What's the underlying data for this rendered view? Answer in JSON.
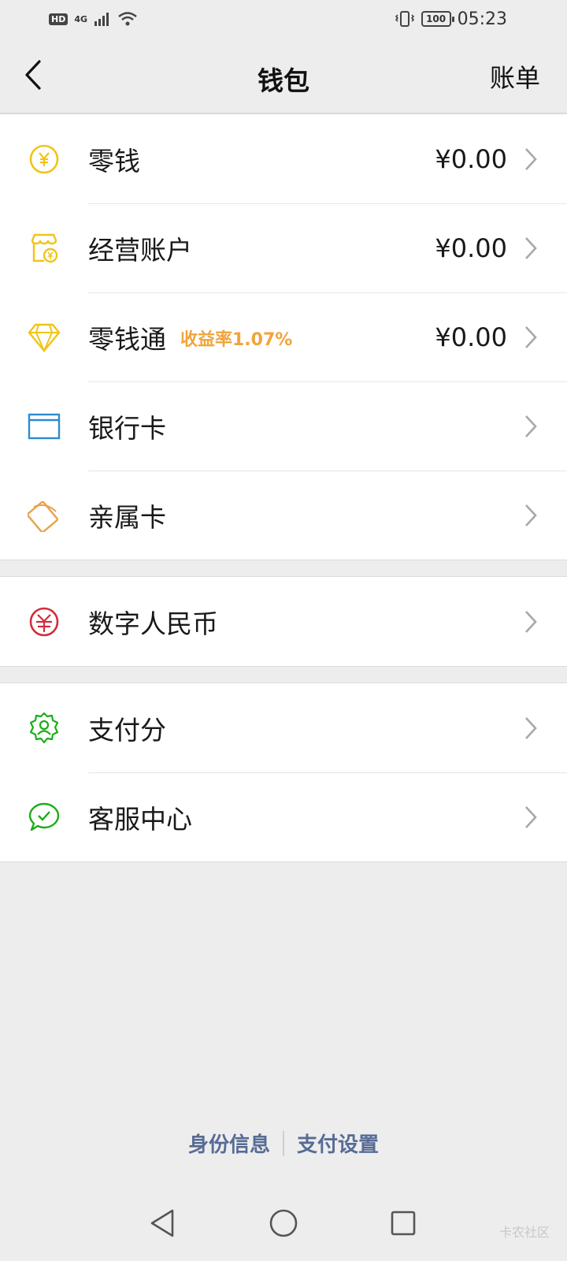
{
  "status_bar": {
    "hd": "HD",
    "network": "4G",
    "battery": "100",
    "time": "05:23"
  },
  "navbar": {
    "title": "钱包",
    "right_action": "账单"
  },
  "groups": [
    {
      "items": [
        {
          "label": "零钱",
          "value": "¥0.00",
          "icon": "yuan-coin-icon",
          "color": "#f0c419"
        },
        {
          "label": "经营账户",
          "value": "¥0.00",
          "icon": "shop-account-icon",
          "color": "#f0c419"
        },
        {
          "label": "零钱通",
          "badge": "收益率1.07%",
          "value": "¥0.00",
          "icon": "diamond-icon",
          "color": "#f0c419"
        },
        {
          "label": "银行卡",
          "icon": "bank-card-icon",
          "color": "#2e8bd0"
        },
        {
          "label": "亲属卡",
          "icon": "family-card-icon",
          "color": "#e8a24a"
        }
      ]
    },
    {
      "items": [
        {
          "label": "数字人民币",
          "icon": "digital-rmb-icon",
          "color": "#d42b3a"
        }
      ]
    },
    {
      "items": [
        {
          "label": "支付分",
          "icon": "pay-score-icon",
          "color": "#1aad19"
        },
        {
          "label": "客服中心",
          "icon": "customer-service-icon",
          "color": "#1aad19"
        }
      ]
    }
  ],
  "footer": {
    "identity": "身份信息",
    "pay_settings": "支付设置"
  },
  "watermark": "卡农社区",
  "colors": {
    "background": "#ededed",
    "link": "#576b95",
    "badge": "#f0a43a"
  }
}
